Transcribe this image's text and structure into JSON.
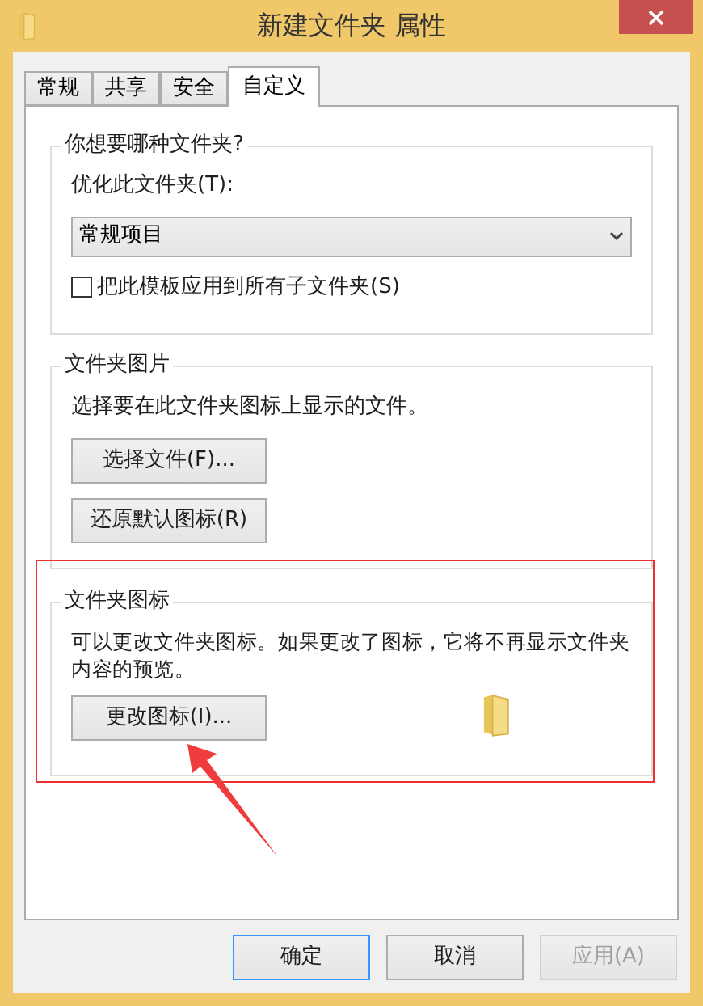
{
  "window": {
    "title": "新建文件夹 属性"
  },
  "tabs": [
    {
      "label": "常规",
      "selected": false
    },
    {
      "label": "共享",
      "selected": false
    },
    {
      "label": "安全",
      "selected": false
    },
    {
      "label": "自定义",
      "selected": true
    }
  ],
  "folder_type": {
    "title": "你想要哪种文件夹?",
    "optimize_label": "优化此文件夹(T):",
    "dropdown_value": "常规项目",
    "apply_subfolders": {
      "label": "把此模板应用到所有子文件夹(S)",
      "checked": false
    }
  },
  "folder_pictures": {
    "title": "文件夹图片",
    "description": "选择要在此文件夹图标上显示的文件。",
    "buttons": [
      "选择文件(F)...",
      "还原默认图标(R)"
    ]
  },
  "folder_icons": {
    "title": "文件夹图标",
    "description": "可以更改文件夹图标。如果更改了图标，它将不再显示文件夹内容的预览。",
    "button": "更改图标(I)..."
  },
  "buttons": [
    {
      "label": "确定",
      "disabled": false,
      "default": true
    },
    {
      "label": "取消",
      "disabled": false,
      "default": false
    },
    {
      "label": "应用(A)",
      "disabled": true,
      "default": false
    }
  ]
}
